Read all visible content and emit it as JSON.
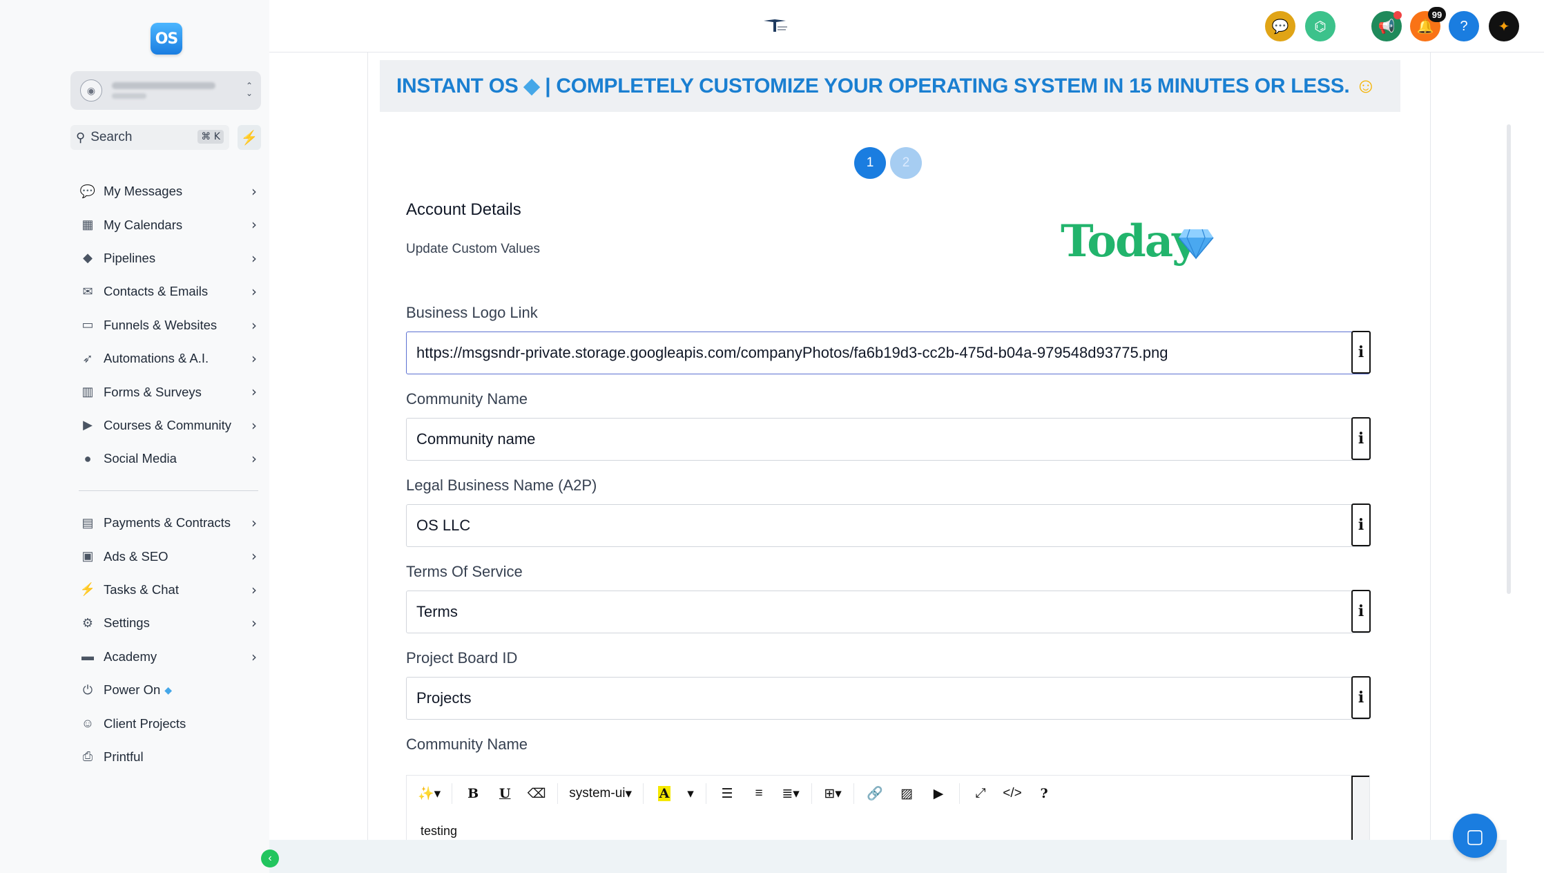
{
  "sidebar": {
    "logo_text": "OS",
    "search": {
      "label": "Search",
      "shortcut": "⌘ K"
    },
    "items": [
      {
        "label": "My Messages",
        "icon": "messages-icon"
      },
      {
        "label": "My Calendars",
        "icon": "calendar-icon"
      },
      {
        "label": "Pipelines",
        "icon": "funnel-icon"
      },
      {
        "label": "Contacts & Emails",
        "icon": "envelope-icon"
      },
      {
        "label": "Funnels & Websites",
        "icon": "monitor-icon"
      },
      {
        "label": "Automations & A.I.",
        "icon": "rocket-icon"
      },
      {
        "label": "Forms & Surveys",
        "icon": "chart-icon"
      },
      {
        "label": "Courses & Community",
        "icon": "play-icon"
      },
      {
        "label": "Social Media",
        "icon": "apple-icon"
      }
    ],
    "items2": [
      {
        "label": "Payments & Contracts",
        "icon": "document-icon"
      },
      {
        "label": "Ads & SEO",
        "icon": "ad-icon"
      },
      {
        "label": "Tasks & Chat",
        "icon": "bolt-icon"
      },
      {
        "label": "Settings",
        "icon": "gear-icon"
      },
      {
        "label": "Academy",
        "icon": "card-icon"
      },
      {
        "label": "Power On",
        "icon": "power-icon"
      },
      {
        "label": "Client Projects",
        "icon": "user-icon"
      },
      {
        "label": "Printful",
        "icon": "printer-icon"
      }
    ]
  },
  "topbar": {
    "notification_count": "99"
  },
  "banner": {
    "text_part1": "INSTANT OS ",
    "text_part2": " | COMPLETELY CUSTOMIZE YOUR OPERATING SYSTEM IN 15 MINUTES OR LESS. "
  },
  "steps": [
    "1",
    "2"
  ],
  "account": {
    "title": "Account Details",
    "subtitle": "Update Custom Values",
    "today": "Today"
  },
  "fields": [
    {
      "label": "Business Logo Link",
      "value": "https://msgsndr-private.storage.googleapis.com/companyPhotos/fa6b19d3-cc2b-475d-b04a-979548d93775.png"
    },
    {
      "label": "Community Name",
      "value": "Community name"
    },
    {
      "label": "Legal Business Name (A2P)",
      "value": "OS LLC"
    },
    {
      "label": "Terms Of Service",
      "value": "Terms"
    },
    {
      "label": "Project Board ID",
      "value": "Projects"
    }
  ],
  "editor": {
    "label": "Community Name",
    "font": "system-ui",
    "text": "testing"
  },
  "colors": {
    "accent": "#1a7de0",
    "banner_text": "#1a7fd1",
    "today_green": "#22b46c",
    "sidebar_bg": "#f8f9fa"
  }
}
